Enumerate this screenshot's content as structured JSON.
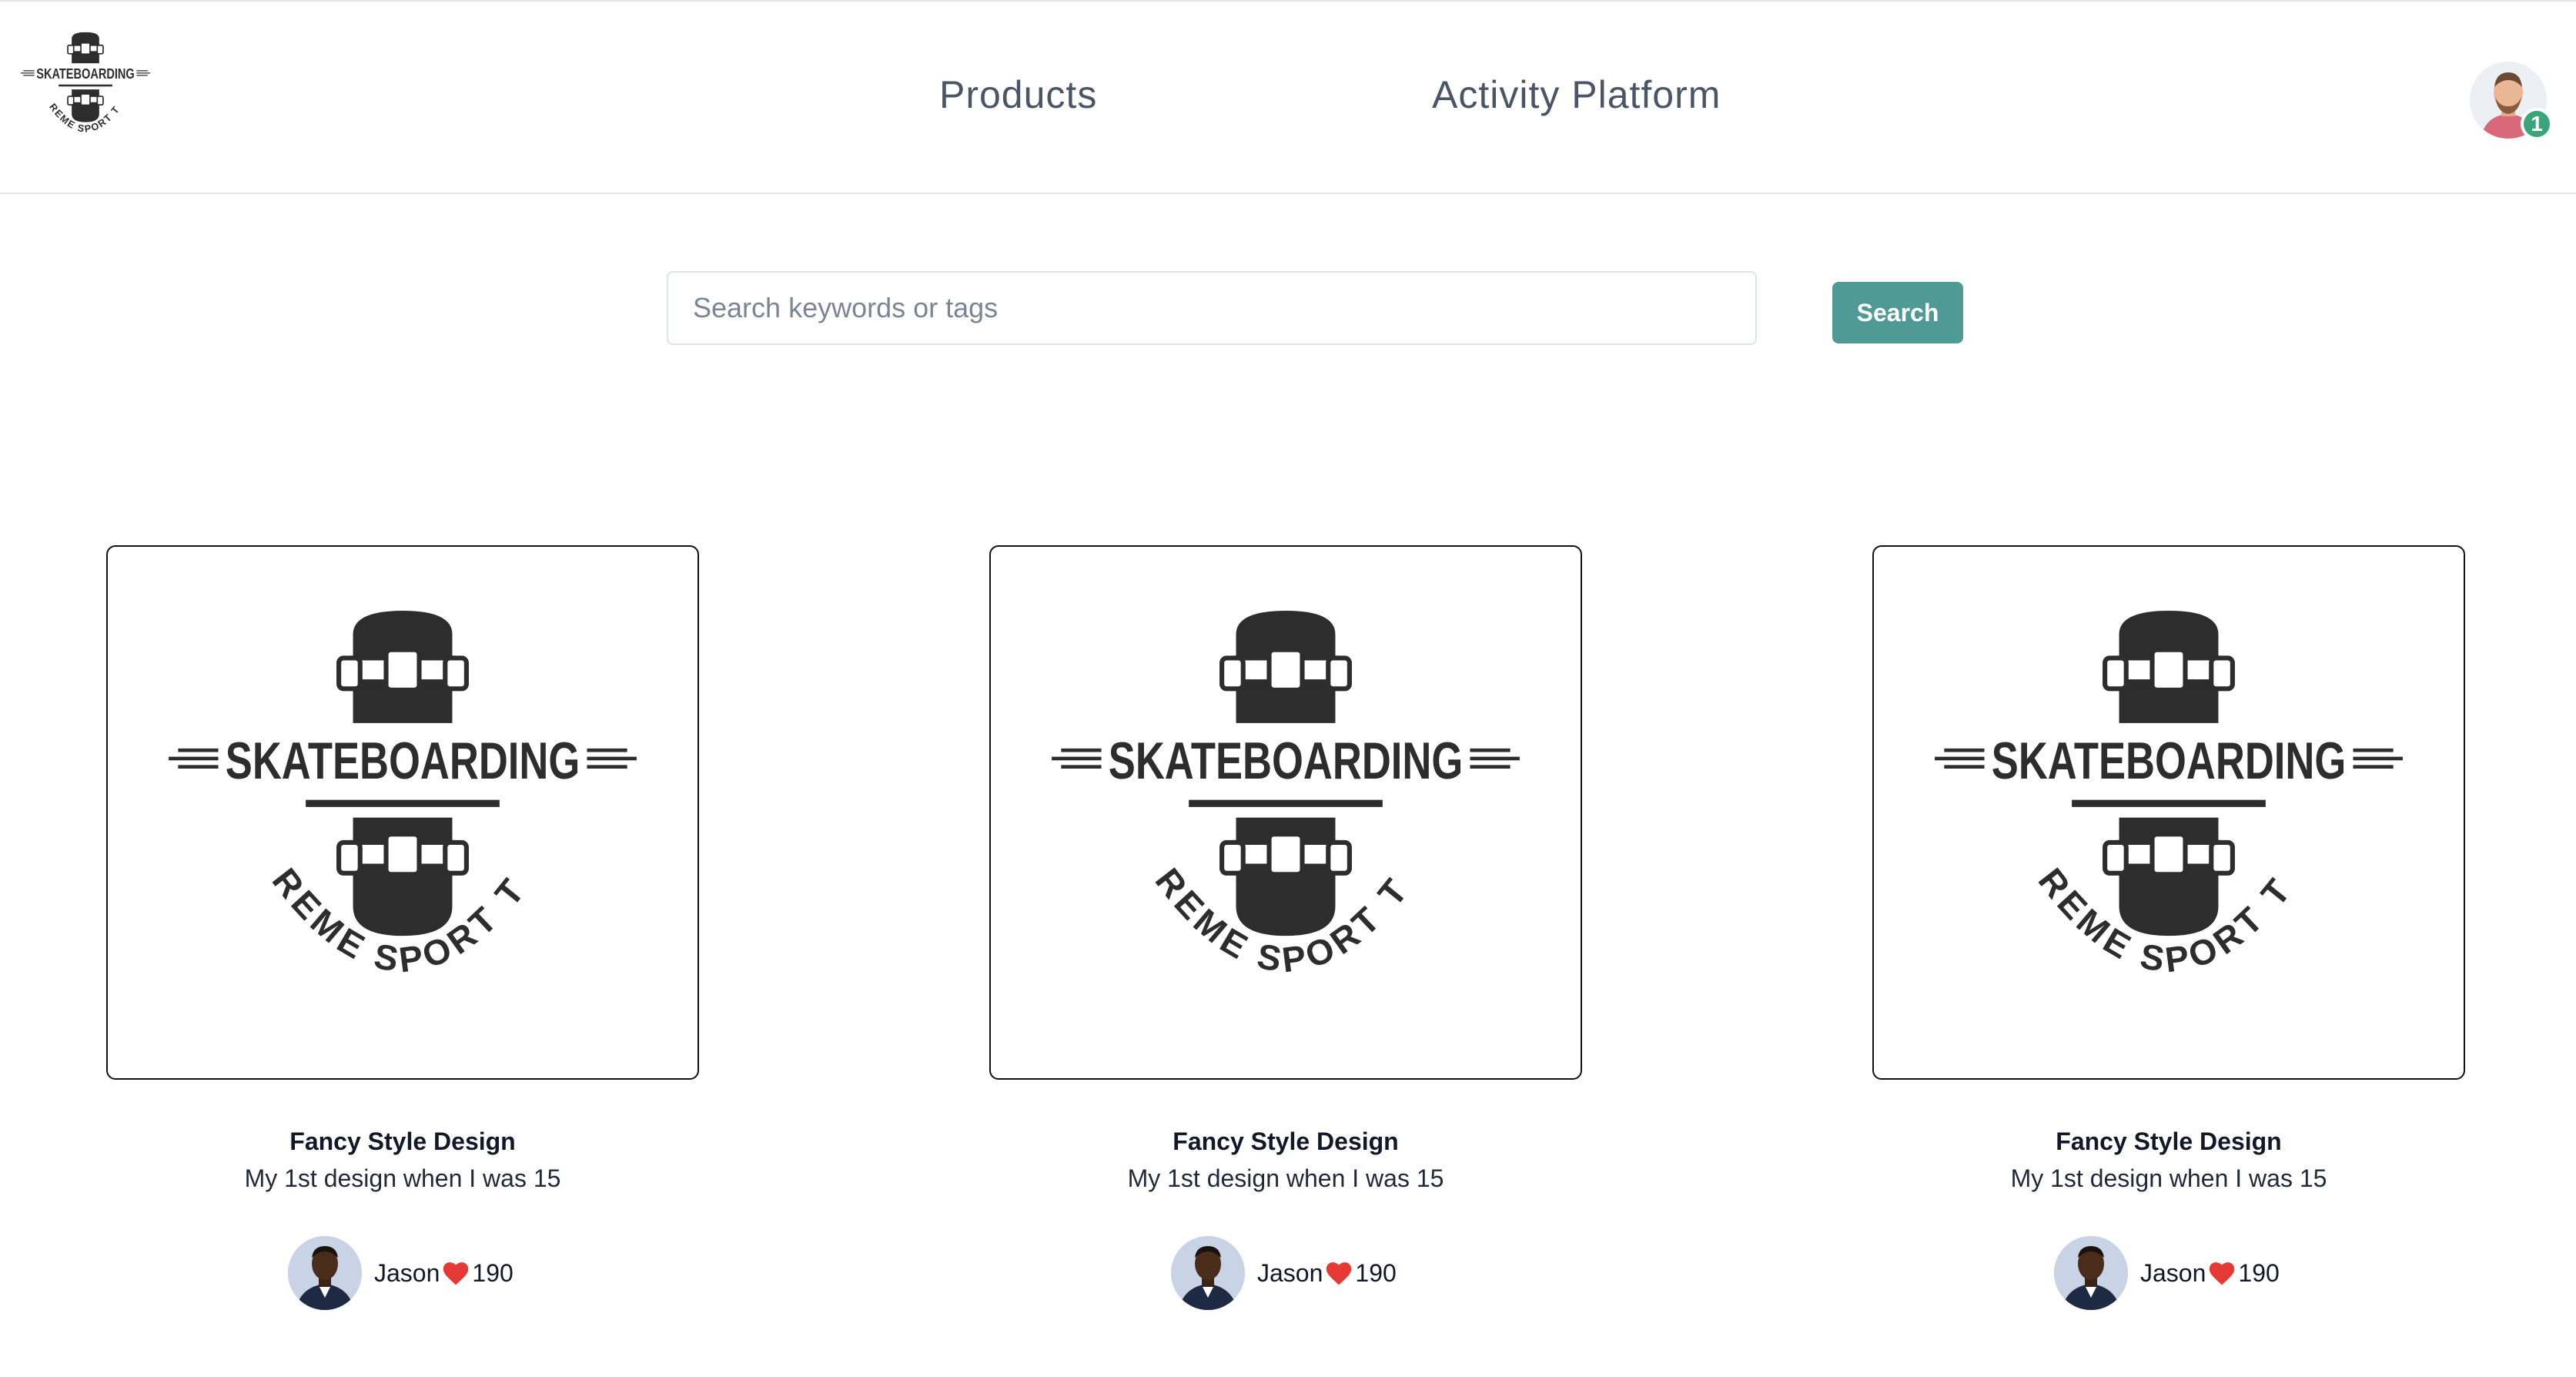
{
  "header": {
    "logo": {
      "name": "skateboarding-logo",
      "title": "SKATEBOARDING",
      "subtitle": "EXTREME SPORT TEAM"
    },
    "nav": [
      {
        "label": "Products"
      },
      {
        "label": "Activity Platform"
      }
    ],
    "user": {
      "notification_count": "1"
    }
  },
  "search": {
    "placeholder": "Search keywords or tags",
    "value": "",
    "button_label": "Search"
  },
  "cards": [
    {
      "image_title": "SKATEBOARDING",
      "image_subtitle": "EXTREME SPORT TEAM",
      "title": "Fancy Style Design",
      "description": "My 1st design when I was 15",
      "author": "Jason",
      "likes": "190"
    },
    {
      "image_title": "SKATEBOARDING",
      "image_subtitle": "EXTREME SPORT TEAM",
      "title": "Fancy Style Design",
      "description": "My 1st design when I was 15",
      "author": "Jason",
      "likes": "190"
    },
    {
      "image_title": "SKATEBOARDING",
      "image_subtitle": "EXTREME SPORT TEAM",
      "title": "Fancy Style Design",
      "description": "My 1st design when I was 15",
      "author": "Jason",
      "likes": "190"
    }
  ],
  "colors": {
    "accent": "#4f9a94",
    "badge": "#3aa57a",
    "heart": "#e53935",
    "logo_dark": "#2d2d2d"
  }
}
